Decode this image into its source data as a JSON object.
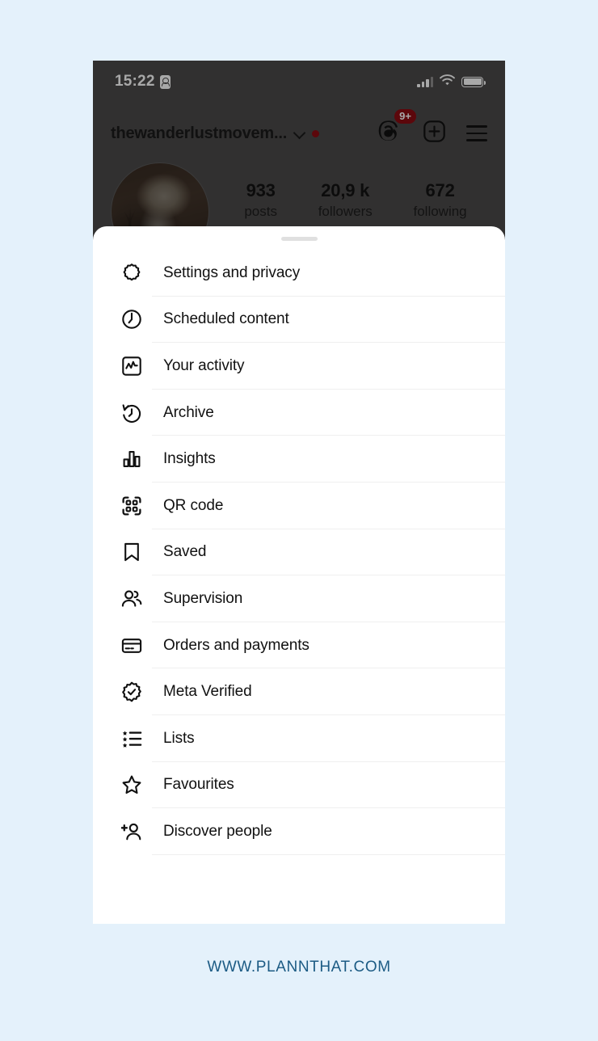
{
  "status_bar": {
    "time": "15:22",
    "recording_icon": "screen-record-icon",
    "signal_icon": "cellular-signal-icon",
    "wifi_icon": "wifi-icon",
    "battery_icon": "battery-full-icon"
  },
  "instagram_header": {
    "username": "thewanderlustmovem...",
    "dropdown_icon": "chevron-down-icon",
    "notification_dot": "red-dot-indicator",
    "threads_icon": "threads-logo-icon",
    "threads_badge": "9+",
    "create_icon": "plus-square-icon",
    "menu_icon": "hamburger-menu-icon"
  },
  "profile": {
    "avatar": "profile-avatar",
    "stats": [
      {
        "value": "933",
        "label": "posts"
      },
      {
        "value": "20,9 k",
        "label": "followers"
      },
      {
        "value": "672",
        "label": "following"
      }
    ]
  },
  "sheet": {
    "grabber": "sheet-grabber-handle",
    "items": [
      {
        "label": "Settings and privacy",
        "icon": "settings-gear-icon"
      },
      {
        "label": "Scheduled content",
        "icon": "clock-icon"
      },
      {
        "label": "Your activity",
        "icon": "activity-chart-icon"
      },
      {
        "label": "Archive",
        "icon": "archive-clock-back-icon"
      },
      {
        "label": "Insights",
        "icon": "bar-chart-icon"
      },
      {
        "label": "QR code",
        "icon": "qr-code-icon"
      },
      {
        "label": "Saved",
        "icon": "bookmark-icon"
      },
      {
        "label": "Supervision",
        "icon": "two-people-icon"
      },
      {
        "label": "Orders and payments",
        "icon": "credit-card-icon"
      },
      {
        "label": "Meta Verified",
        "icon": "verified-badge-icon"
      },
      {
        "label": "Lists",
        "icon": "star-list-icon"
      },
      {
        "label": "Favourites",
        "icon": "star-outline-icon"
      },
      {
        "label": "Discover people",
        "icon": "add-person-icon"
      }
    ]
  },
  "footer": {
    "watermark": "WWW.PLANNTHAT.COM"
  },
  "colors": {
    "page_background": "#e4f1fb",
    "sheet_background": "#ffffff",
    "badge_red": "#8c0b12",
    "footer_text": "#1c5b84",
    "divider": "#efefef"
  }
}
